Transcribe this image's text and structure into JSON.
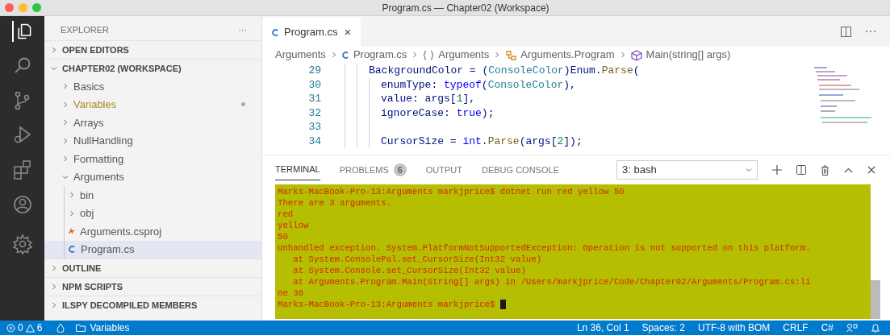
{
  "window": {
    "title": "Program.cs — Chapter02 (Workspace)"
  },
  "activity_bar": [
    {
      "kind": "files",
      "selected": true
    },
    {
      "kind": "search",
      "selected": false
    },
    {
      "kind": "source-control",
      "selected": false
    },
    {
      "kind": "run",
      "selected": false
    },
    {
      "kind": "extensions",
      "selected": false
    },
    {
      "kind": "accounts",
      "selected": false
    },
    {
      "kind": "settings",
      "selected": false
    }
  ],
  "sidebar": {
    "title": "EXPLORER",
    "more": "···",
    "sections": [
      {
        "label": "OPEN EDITORS",
        "expanded": false
      },
      {
        "label": "CHAPTER02 (WORKSPACE)",
        "expanded": true,
        "items": [
          {
            "label": "Basics",
            "kind": "folder",
            "expanded": false,
            "modified": false,
            "selected": false
          },
          {
            "label": "Variables",
            "kind": "folder",
            "expanded": false,
            "modified": true,
            "selected": false
          },
          {
            "label": "Arrays",
            "kind": "folder",
            "expanded": false,
            "modified": false,
            "selected": false
          },
          {
            "label": "NullHandling",
            "kind": "folder",
            "expanded": false,
            "modified": false,
            "selected": false
          },
          {
            "label": "Formatting",
            "kind": "folder",
            "expanded": false,
            "modified": false,
            "selected": false
          },
          {
            "label": "Arguments",
            "kind": "folder",
            "expanded": true,
            "modified": false,
            "selected": false,
            "children": [
              {
                "label": "bin",
                "kind": "folder",
                "expanded": false,
                "modified": false,
                "selected": false
              },
              {
                "label": "obj",
                "kind": "folder",
                "expanded": false,
                "modified": false,
                "selected": false
              },
              {
                "label": "Arguments.csproj",
                "kind": "project",
                "modified": false,
                "selected": false
              },
              {
                "label": "Program.cs",
                "kind": "csharp",
                "modified": false,
                "selected": true
              }
            ]
          }
        ]
      },
      {
        "label": "OUTLINE",
        "expanded": false
      },
      {
        "label": "NPM SCRIPTS",
        "expanded": false
      },
      {
        "label": "ILSPY DECOMPILED MEMBERS",
        "expanded": false
      }
    ]
  },
  "tabs": [
    {
      "label": "Program.cs",
      "close": "×",
      "selected": true
    }
  ],
  "breadcrumbs": [
    {
      "label": "Arguments",
      "kind": "folder"
    },
    {
      "label": "Program.cs",
      "kind": "csharp"
    },
    {
      "label": "Arguments",
      "kind": "namespace"
    },
    {
      "label": "Arguments.Program",
      "kind": "class"
    },
    {
      "label": "Main(string[] args)",
      "kind": "method"
    }
  ],
  "code": [
    {
      "number": "29",
      "kind": "outer",
      "tokens": [
        {
          "text": "BackgroundColor = (",
          "kind": "plain"
        },
        {
          "text": "ConsoleColor",
          "kind": "type"
        },
        {
          "text": ")Enum.",
          "kind": "plain"
        },
        {
          "text": "Parse",
          "kind": "method"
        },
        {
          "text": "(",
          "kind": "plain"
        }
      ]
    },
    {
      "number": "30",
      "kind": "inner",
      "tokens": [
        {
          "text": "enumType: ",
          "kind": "plain"
        },
        {
          "text": "typeof",
          "kind": "keyword"
        },
        {
          "text": "(",
          "kind": "plain"
        },
        {
          "text": "ConsoleColor",
          "kind": "type"
        },
        {
          "text": "),",
          "kind": "plain"
        }
      ]
    },
    {
      "number": "31",
      "kind": "inner",
      "tokens": [
        {
          "text": "value: args[",
          "kind": "plain"
        },
        {
          "text": "1",
          "kind": "number"
        },
        {
          "text": "],",
          "kind": "plain"
        }
      ]
    },
    {
      "number": "32",
      "kind": "inner",
      "tokens": [
        {
          "text": "ignoreCase: ",
          "kind": "plain"
        },
        {
          "text": "true",
          "kind": "keyword"
        },
        {
          "text": ");",
          "kind": "plain"
        }
      ]
    },
    {
      "number": "33",
      "kind": "inner"
    },
    {
      "number": "34",
      "kind": "inner",
      "tokens": [
        {
          "text": "CursorSize = ",
          "kind": "plain"
        },
        {
          "text": "int",
          "kind": "keyword"
        },
        {
          "text": ".",
          "kind": "plain"
        },
        {
          "text": "Parse",
          "kind": "method"
        },
        {
          "text": "(args[",
          "kind": "plain"
        },
        {
          "text": "2",
          "kind": "number"
        },
        {
          "text": "]);",
          "kind": "plain"
        }
      ]
    }
  ],
  "panel": {
    "tabs": [
      {
        "label": "TERMINAL",
        "selected": true
      },
      {
        "label": "PROBLEMS",
        "badge": "6",
        "selected": false
      },
      {
        "label": "OUTPUT",
        "selected": false
      },
      {
        "label": "DEBUG CONSOLE",
        "selected": false
      }
    ],
    "terminal_select": "3: bash",
    "terminal_lines": [
      "Marks-MacBook-Pro-13:Arguments markjprice$ dotnet run red yellow 50",
      "There are 3 arguments.",
      "red",
      "yellow",
      "50",
      "Unhandled exception. System.PlatformNotSupportedException: Operation is not supported on this platform.",
      "   at System.ConsolePal.set_CursorSize(Int32 value)",
      "   at System.Console.set_CursorSize(Int32 value)",
      "   at Arguments.Program.Main(String[] args) in /Users/markjprice/Code/Chapter02/Arguments/Program.cs:li",
      "ne 36",
      "Marks-MacBook-Pro-13:Arguments markjprice$ "
    ]
  },
  "status_bar": {
    "errors": "0",
    "warnings": "6",
    "folder": "Variables",
    "right": [
      "Ln 36, Col 1",
      "Spaces: 2",
      "UTF-8 with BOM",
      "CRLF",
      "C#"
    ]
  }
}
